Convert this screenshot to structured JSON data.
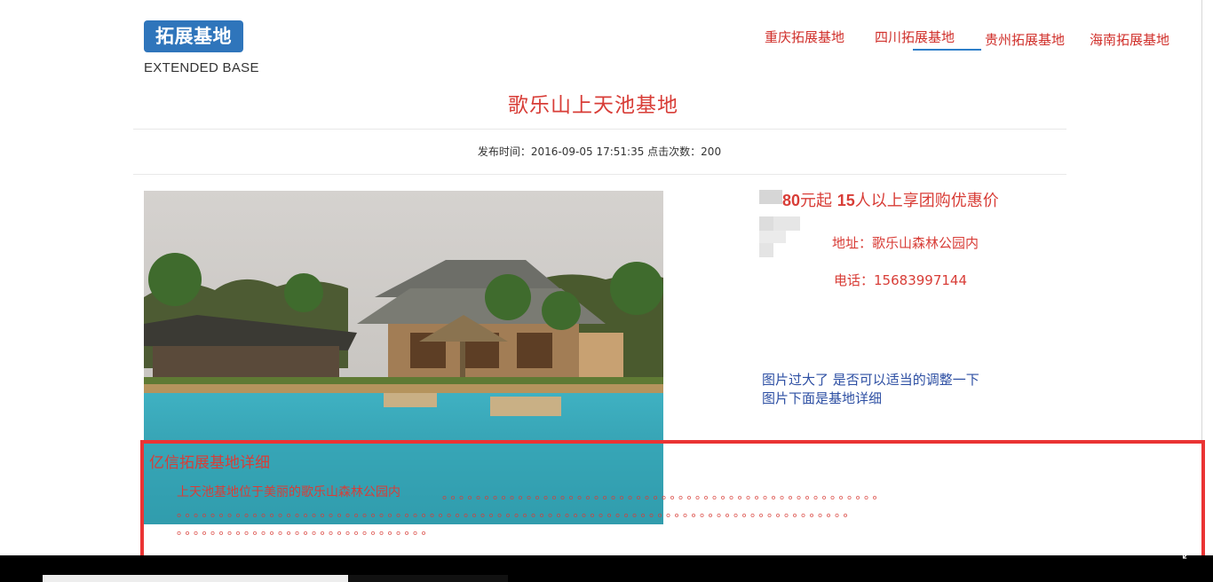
{
  "header": {
    "logo_text": "拓展基地",
    "logo_subtitle": "EXTENDED BASE",
    "nav": [
      {
        "label": "重庆拓展基地"
      },
      {
        "label": "四川拓展基地",
        "active": true
      },
      {
        "label": "贵州拓展基地"
      },
      {
        "label": "海南拓展基地"
      }
    ]
  },
  "article": {
    "title": "歌乐山上天池基地",
    "meta": "发布时间：2016-09-05 17:51:35 点击次数：200",
    "image_alt": "resort pool",
    "price": {
      "amount": "80",
      "text_a": "元起 ",
      "count": "15",
      "text_b": "人以上享团购优惠价"
    },
    "address": "地址：歌乐山森林公园内",
    "phone_label": "电话：",
    "phone_value": "15683997144",
    "note_line1": "图片过大了 是否可以适当的调整一下",
    "note_line2": "图片下面是基地详细",
    "details_heading": "亿信拓展基地详细",
    "details_text": "上天池基地位于美丽的歌乐山森林公园内"
  },
  "theme": {
    "accent_red": "#d83d37",
    "brand_blue": "#2f75bb",
    "note_blue": "#2d4fa3",
    "highlight": "#ea3434"
  },
  "icons": {
    "corner": "resize-corner-icon"
  }
}
